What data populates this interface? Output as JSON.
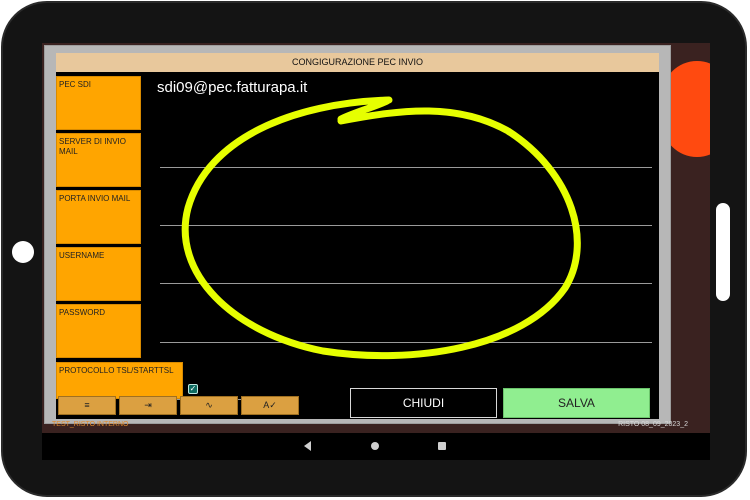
{
  "dialog": {
    "title": "CONGIGURAZIONE PEC INVIO",
    "labels": [
      "PEC SDI",
      "SERVER DI INVIO MAIL",
      "PORTA INVIO MAIL",
      "USERNAME",
      "PASSWORD",
      "PROTOCOLLO TSL/STARTTSL"
    ],
    "pec_sdi_value": "sdi09@pec.fatturapa.it",
    "protocol_checked": true,
    "toolbar": [
      {
        "icon": "align-right-icon",
        "glyph": "≡"
      },
      {
        "icon": "indent-icon",
        "glyph": "⇥"
      },
      {
        "icon": "waveform-icon",
        "glyph": "∿"
      },
      {
        "icon": "spellcheck-icon",
        "glyph": "A✓"
      }
    ],
    "close_label": "CHIUDI",
    "save_label": "SALVA"
  },
  "status": {
    "left": "TEST_RISTO INTERNO",
    "right": "RISTO 08_09_2023_2"
  },
  "colors": {
    "label_orange": "#ffa500",
    "title_tan": "#e8c89c",
    "save_green": "#90ee90",
    "highlight_yellow": "#e6ff00"
  }
}
